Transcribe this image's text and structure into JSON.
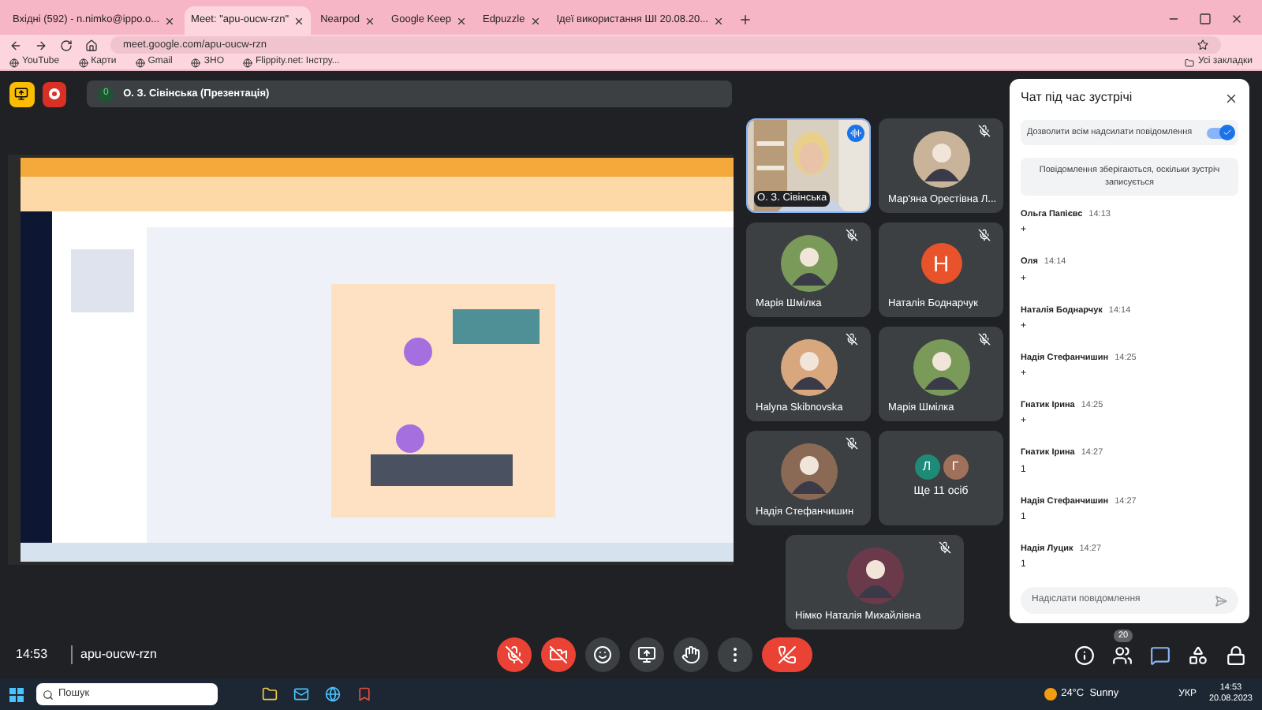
{
  "browser": {
    "tabs": [
      {
        "label": "Вхідні (592) - n.nimko@ippo.o...",
        "selected": false
      },
      {
        "label": "Meet: \"apu-oucw-rzn\"",
        "selected": true
      },
      {
        "label": "Nearpod",
        "selected": false
      },
      {
        "label": "Google Keep",
        "selected": false
      },
      {
        "label": "Edpuzzle",
        "selected": false
      },
      {
        "label": "Ідеї використання ШІ 20.08.20...",
        "selected": false
      }
    ],
    "address": "meet.google.com/apu-oucw-rzn",
    "bookmarks": [
      "YouTube",
      "Карти",
      "Gmail",
      "ЗНО",
      "Flippity.net: Інстру..."
    ],
    "all_bookmarks": "Усі закладки"
  },
  "presentation": {
    "count": "0",
    "title": "О. З. Сівінська (Презентація)",
    "kind": "picture"
  },
  "tiles": [
    {
      "kind": "video",
      "name": "О. З. Сівінська",
      "muted": false
    },
    {
      "kind": "avatar",
      "name": "Мар'яна Орестівна Л...",
      "muted": true,
      "color": "#c9b49a"
    },
    {
      "kind": "avatar",
      "name": "Марія Шмілка",
      "muted": true,
      "color": "#7a9a5a"
    },
    {
      "kind": "letter",
      "name": "Наталія Боднарчук",
      "muted": true,
      "letter": "Н",
      "color": "#e8532b"
    },
    {
      "kind": "avatar",
      "name": "Halyna Skibnovska",
      "muted": true,
      "color": "#d9a77e"
    },
    {
      "kind": "avatar",
      "name": "Марія Шмілка",
      "muted": true,
      "color": "#7a9a5a"
    },
    {
      "kind": "avatar",
      "name": "Надія Стефанчишин",
      "muted": true,
      "color": "#8a6a55"
    },
    {
      "kind": "more",
      "name": "Ще 11 осіб",
      "letters": [
        {
          "letter": "Л",
          "color": "#1e8a78"
        },
        {
          "letter": "Г",
          "color": "#a0705a"
        }
      ]
    },
    {
      "kind": "avatar",
      "name": "Німко Наталія Михайлівна",
      "muted": true,
      "color": "#6a3a4a"
    }
  ],
  "chat": {
    "title": "Чат під час зустрічі",
    "allow_all": {
      "label": "Дозволити всім надсилати повідомлення",
      "on": true
    },
    "notice": "Повідомлення зберігаються, оскільки зустріч записується",
    "messages": [
      {
        "author": "Ольга Папієвс",
        "time": "14:13",
        "text": "+"
      },
      {
        "author": "Оля",
        "time": "14:14",
        "text": "+"
      },
      {
        "author": "Наталія Боднарчук",
        "time": "14:14",
        "text": "+"
      },
      {
        "author": "Надія Стефанчишин",
        "time": "14:25",
        "text": "+"
      },
      {
        "author": "Гнатик Ірина",
        "time": "14:25",
        "text": "+"
      },
      {
        "author": "Гнатик Ірина",
        "time": "14:27",
        "text": "1"
      },
      {
        "author": "Надія Стефанчишин",
        "time": "14:27",
        "text": "1"
      },
      {
        "author": "Надія Луцик",
        "time": "14:27",
        "text": "1"
      }
    ],
    "placeholder": "Надіслати повідомлення"
  },
  "call_bar": {
    "time": "14:53",
    "code": "apu-oucw-rzn",
    "controls": [
      {
        "kind": "mic",
        "on": false
      },
      {
        "kind": "camera",
        "on": false
      },
      {
        "kind": "emoji"
      },
      {
        "kind": "present"
      },
      {
        "kind": "hand"
      },
      {
        "kind": "more"
      },
      {
        "kind": "leave"
      }
    ],
    "side": [
      {
        "kind": "info",
        "selected": false
      },
      {
        "kind": "people",
        "selected": false,
        "badge": "20"
      },
      {
        "kind": "chat",
        "selected": true
      },
      {
        "kind": "activities",
        "selected": false
      },
      {
        "kind": "host",
        "selected": false
      }
    ]
  },
  "taskbar": {
    "search": "Пошук",
    "weather": "24°C  Sunny",
    "language": "УКР",
    "time": "14:53",
    "date": "20.08.2023"
  }
}
